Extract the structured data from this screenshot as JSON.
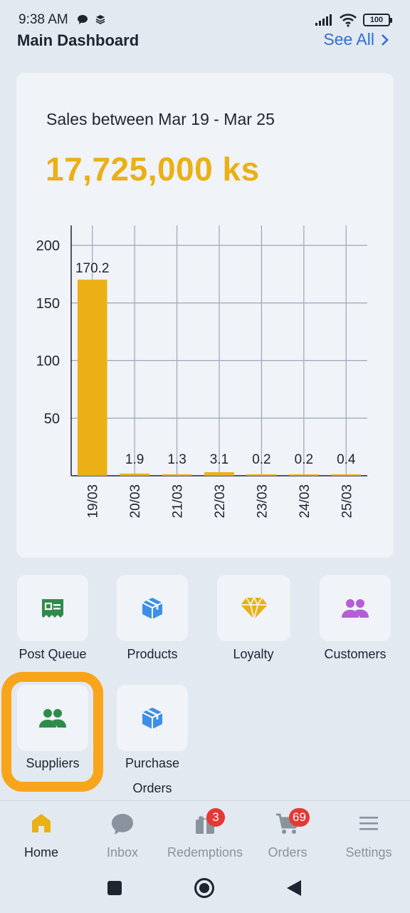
{
  "status_bar": {
    "time": "9:38 AM",
    "battery": "100"
  },
  "header": {
    "title": "Main Dashboard",
    "see_all": "See All"
  },
  "sales_card": {
    "period": "Sales between Mar 19 - Mar 25",
    "total": "17,725,000 ks"
  },
  "chart_data": {
    "type": "bar",
    "categories": [
      "19/03",
      "20/03",
      "21/03",
      "22/03",
      "23/03",
      "24/03",
      "25/03"
    ],
    "values": [
      170.2,
      1.9,
      1.3,
      3.1,
      0.2,
      0.2,
      0.4
    ],
    "value_labels": [
      "170.2",
      "1.9",
      "1.3",
      "3.1",
      "0.2",
      "0.2",
      "0.4"
    ],
    "yticks": [
      50,
      100,
      150,
      200
    ],
    "ylim": [
      0,
      200
    ],
    "grid": true,
    "bar_color": "#eab015"
  },
  "quick_actions": [
    {
      "label": "Post Queue",
      "icon": "post-queue-icon",
      "color": "#2e8b4a"
    },
    {
      "label": "Products",
      "icon": "box-icon",
      "color": "#3d8fe8"
    },
    {
      "label": "Loyalty",
      "icon": "diamond-icon",
      "color": "#eab015"
    },
    {
      "label": "Customers",
      "icon": "people-icon",
      "color": "#b45fd6"
    },
    {
      "label": "Suppliers",
      "icon": "people-icon",
      "color": "#2e8b4a"
    },
    {
      "label": "Purchase",
      "label_line2": "Orders",
      "icon": "box-icon",
      "color": "#3d8fe8"
    }
  ],
  "bottom_nav": [
    {
      "label": "Home",
      "icon": "home-icon",
      "active": true
    },
    {
      "label": "Inbox",
      "icon": "chat-icon"
    },
    {
      "label": "Redemptions",
      "icon": "gift-icon",
      "badge": "3"
    },
    {
      "label": "Orders",
      "icon": "cart-icon",
      "badge": "69"
    },
    {
      "label": "Settings",
      "icon": "menu-icon"
    }
  ],
  "colors": {
    "accent": "#eab015",
    "link": "#2e6fd6",
    "highlight": "#f8a51c",
    "badge": "#e53935",
    "background": "#e3e9f0",
    "card": "#f0f3f7"
  }
}
